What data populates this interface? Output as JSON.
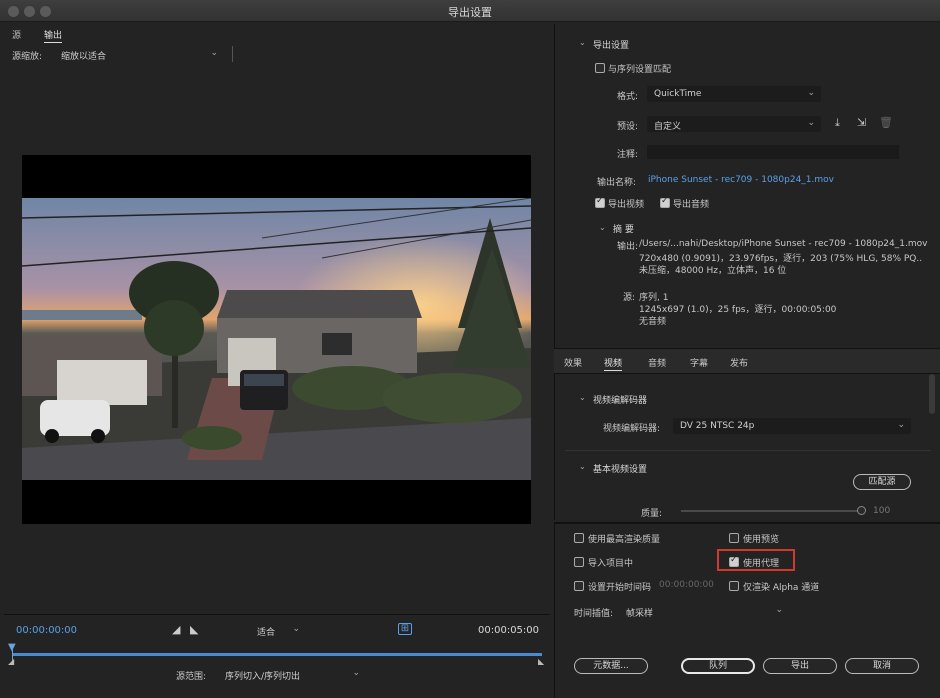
{
  "window": {
    "title": "导出设置"
  },
  "left": {
    "tabs": [
      "源",
      "输出"
    ],
    "source_scale_label": "源缩放:",
    "source_scale_value": "缩放以适合",
    "timecode_start": "00:00:00:00",
    "timecode_end": "00:00:05:00",
    "fit_value": "适合",
    "source_range_label": "源范围:",
    "source_range_value": "序列切入/序列切出"
  },
  "export_settings": {
    "header": "导出设置",
    "match_sequence": "与序列设置匹配",
    "format_label": "格式:",
    "format_value": "QuickTime",
    "preset_label": "预设:",
    "preset_value": "自定义",
    "comment_label": "注释:",
    "output_name_label": "输出名称:",
    "output_name_value": "iPhone Sunset - rec709 - 1080p24_1.mov",
    "export_video": "导出视频",
    "export_audio": "导出音频",
    "summary_header": "摘 要",
    "output_label": "输出:",
    "output_lines": [
      "/Users/...nahi/Desktop/iPhone Sunset - rec709 - 1080p24_1.mov",
      "720x480 (0.9091)，23.976fps，逐行，203 (75% HLG, 58% PQ..",
      "未压缩，48000 Hz，立体声，16 位"
    ],
    "source_label": "源:",
    "source_lines": [
      "序列, 1",
      "1245x697 (1.0)，25 fps，逐行，00:00:05:00",
      "无音频"
    ]
  },
  "tabs": [
    "效果",
    "视频",
    "音频",
    "字幕",
    "发布"
  ],
  "video": {
    "codec_header": "视频编解码器",
    "codec_label": "视频编解码器:",
    "codec_value": "DV 25 NTSC 24p",
    "basic_header": "基本视频设置",
    "match_source": "匹配源",
    "quality_label": "质量:",
    "quality_value": "100"
  },
  "bottom": {
    "max_render_quality": "使用最高渲染质量",
    "use_previews": "使用预览",
    "import_into_project": "导入项目中",
    "use_proxies": "使用代理",
    "set_start_timecode": "设置开始时间码",
    "start_timecode": "00:00:00:00",
    "render_alpha_only": "仅渲染 Alpha 通道",
    "time_interpolation_label": "时间插值:",
    "time_interpolation_value": "帧采样",
    "metadata_button": "元数据...",
    "queue_button": "队列",
    "export_button": "导出",
    "cancel_button": "取消"
  },
  "colors": {
    "accent_blue": "#5aa0e6",
    "highlight_red": "#d03a2a",
    "panel_bg": "#232323"
  }
}
